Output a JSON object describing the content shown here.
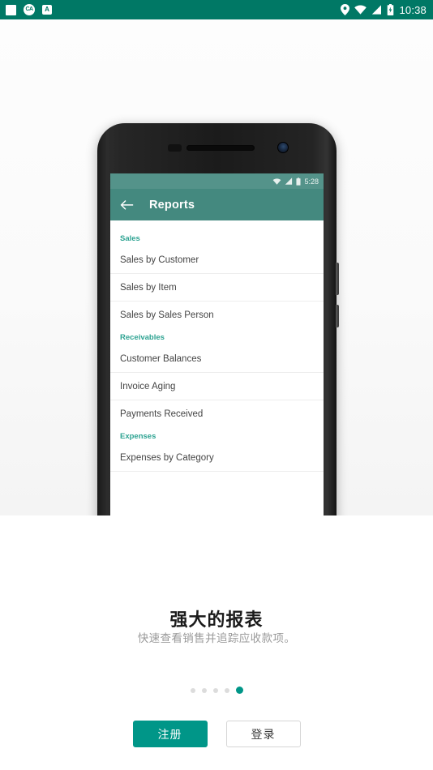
{
  "system_status_bar": {
    "background_color": "#007865",
    "notifications": [
      {
        "icon": "screenshot-notification-icon",
        "glyph": ""
      },
      {
        "icon": "app-circle-notification-icon",
        "glyph": "CA"
      },
      {
        "icon": "app-box-notification-icon",
        "glyph": "A"
      }
    ],
    "indicators": [
      {
        "icon": "location-icon"
      },
      {
        "icon": "wifi-icon"
      },
      {
        "icon": "cellular-signal-icon"
      },
      {
        "icon": "battery-charging-icon"
      }
    ],
    "time": "10:38"
  },
  "phone_mockup": {
    "mini_status_bar": {
      "background_color": "#54938a",
      "indicators": [
        {
          "icon": "wifi-icon"
        },
        {
          "icon": "cellular-signal-icon"
        },
        {
          "icon": "battery-icon"
        }
      ],
      "time": "5:28"
    },
    "app_bar": {
      "background_color": "#44897f",
      "back_icon": "back-arrow-icon",
      "title": "Reports"
    },
    "report_list": {
      "clipped_top_text": "",
      "sections": [
        {
          "header": "Sales",
          "header_color": "#2ea392",
          "items": [
            "Sales by Customer",
            "Sales by Item",
            "Sales by Sales Person"
          ]
        },
        {
          "header": "Receivables",
          "header_color": "#2ea392",
          "items": [
            "Customer Balances",
            "Invoice Aging",
            "Payments Received"
          ]
        },
        {
          "header": "Expenses",
          "header_color": "#2ea392",
          "items": [
            "Expenses by Category"
          ]
        }
      ]
    }
  },
  "onboarding": {
    "headline": "强大的报表",
    "subhead": "快速查看销售并追踪应收款项。",
    "pager": {
      "total": 5,
      "active_index": 4,
      "active_color": "#009688",
      "inactive_color": "#dcdcdc"
    },
    "buttons": {
      "signup_label": "注册",
      "signup_color": "#009688",
      "login_label": "登录"
    }
  }
}
